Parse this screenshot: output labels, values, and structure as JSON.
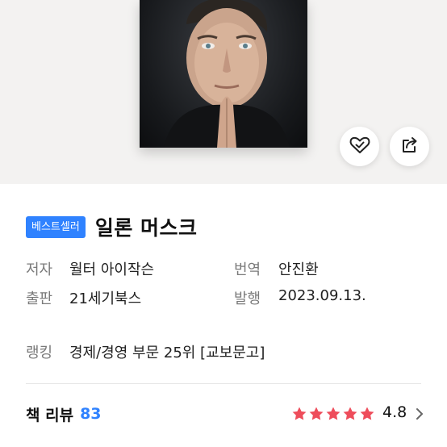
{
  "hero": {
    "like_icon": "heart-check-icon",
    "share_icon": "share-icon"
  },
  "book": {
    "badge": "베스트셀러",
    "title": "일론 머스크",
    "author_label": "저자",
    "author": "월터 아이작슨",
    "translator_label": "번역",
    "translator": "안진환",
    "publisher_label": "출판",
    "publisher": "21세기북스",
    "published_label": "발행",
    "published": "2023.09.13.",
    "ranking_label": "랭킹",
    "ranking": "경제/경영 부문 25위 [교보문고]"
  },
  "review": {
    "label": "책 리뷰",
    "count": "83",
    "rating": "4.8",
    "stars": 5,
    "star_color": "#ee4d5b",
    "chevron_icon": "chevron-right-icon"
  },
  "colors": {
    "accent": "#2f82ff",
    "hero_bg": "#f3f2f1"
  }
}
